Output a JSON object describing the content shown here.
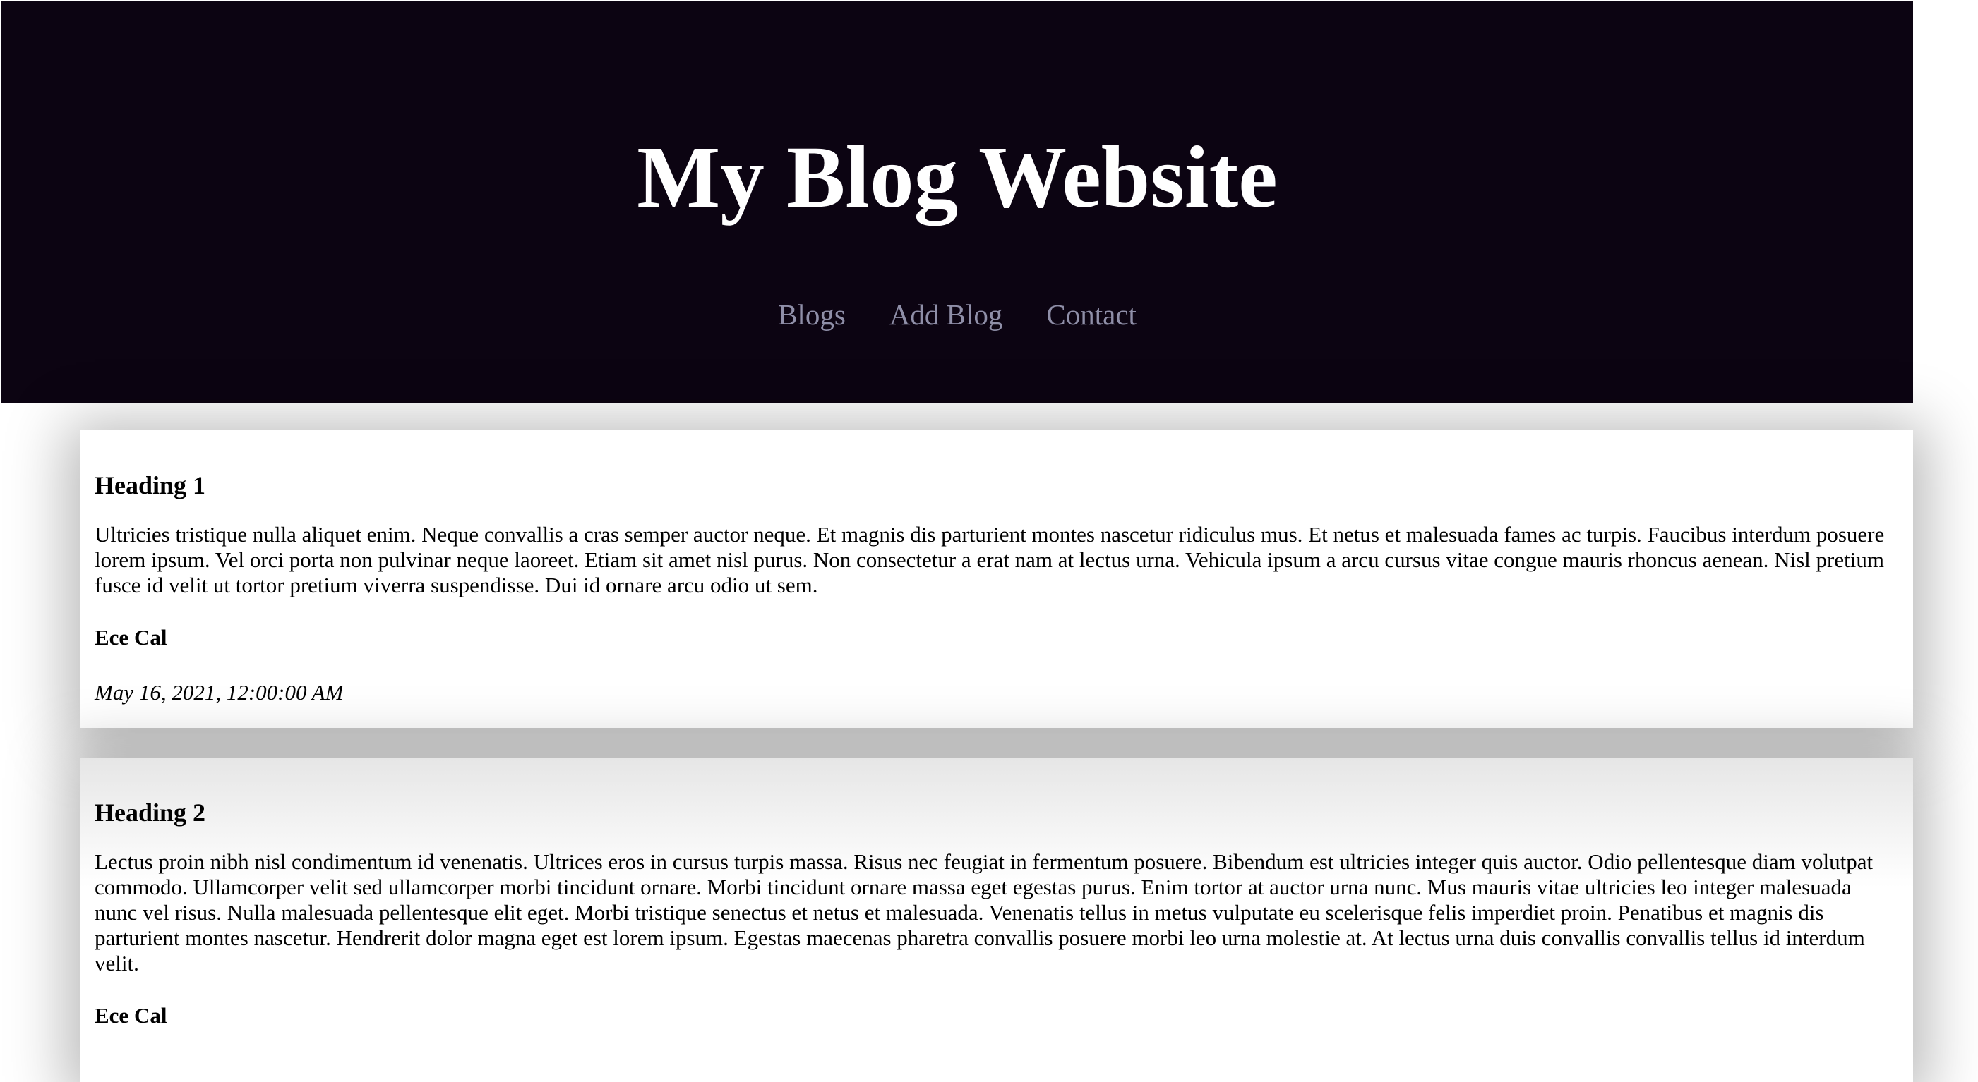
{
  "header": {
    "title": "My Blog Website",
    "nav": [
      "Blogs",
      "Add Blog",
      "Contact"
    ]
  },
  "posts": [
    {
      "title": "Heading 1",
      "body": "Ultricies tristique nulla aliquet enim. Neque convallis a cras semper auctor neque. Et magnis dis parturient montes nascetur ridiculus mus. Et netus et malesuada fames ac turpis. Faucibus interdum posuere lorem ipsum. Vel orci porta non pulvinar neque laoreet. Etiam sit amet nisl purus. Non consectetur a erat nam at lectus urna. Vehicula ipsum a arcu cursus vitae congue mauris rhoncus aenean. Nisl pretium fusce id velit ut tortor pretium viverra suspendisse. Dui id ornare arcu odio ut sem.",
      "author": "Ece Cal",
      "date": "May 16, 2021, 12:00:00 AM"
    },
    {
      "title": "Heading 2",
      "body": "Lectus proin nibh nisl condimentum id venenatis. Ultrices eros in cursus turpis massa. Risus nec feugiat in fermentum posuere. Bibendum est ultricies integer quis auctor. Odio pellentesque diam volutpat commodo. Ullamcorper velit sed ullamcorper morbi tincidunt ornare. Morbi tincidunt ornare massa eget egestas purus. Enim tortor at auctor urna nunc. Mus mauris vitae ultricies leo integer malesuada nunc vel risus. Nulla malesuada pellentesque elit eget. Morbi tristique senectus et netus et malesuada. Venenatis tellus in metus vulputate eu scelerisque felis imperdiet proin. Penatibus et magnis dis parturient montes nascetur. Hendrerit dolor magna eget est lorem ipsum. Egestas maecenas pharetra convallis posuere morbi leo urna molestie at. At lectus urna duis convallis convallis tellus id interdum velit.",
      "author": "Ece Cal"
    }
  ],
  "colors": {
    "header_bg": "#0c0412",
    "title": "#ffffff",
    "nav_link": "#8f8fa8"
  }
}
